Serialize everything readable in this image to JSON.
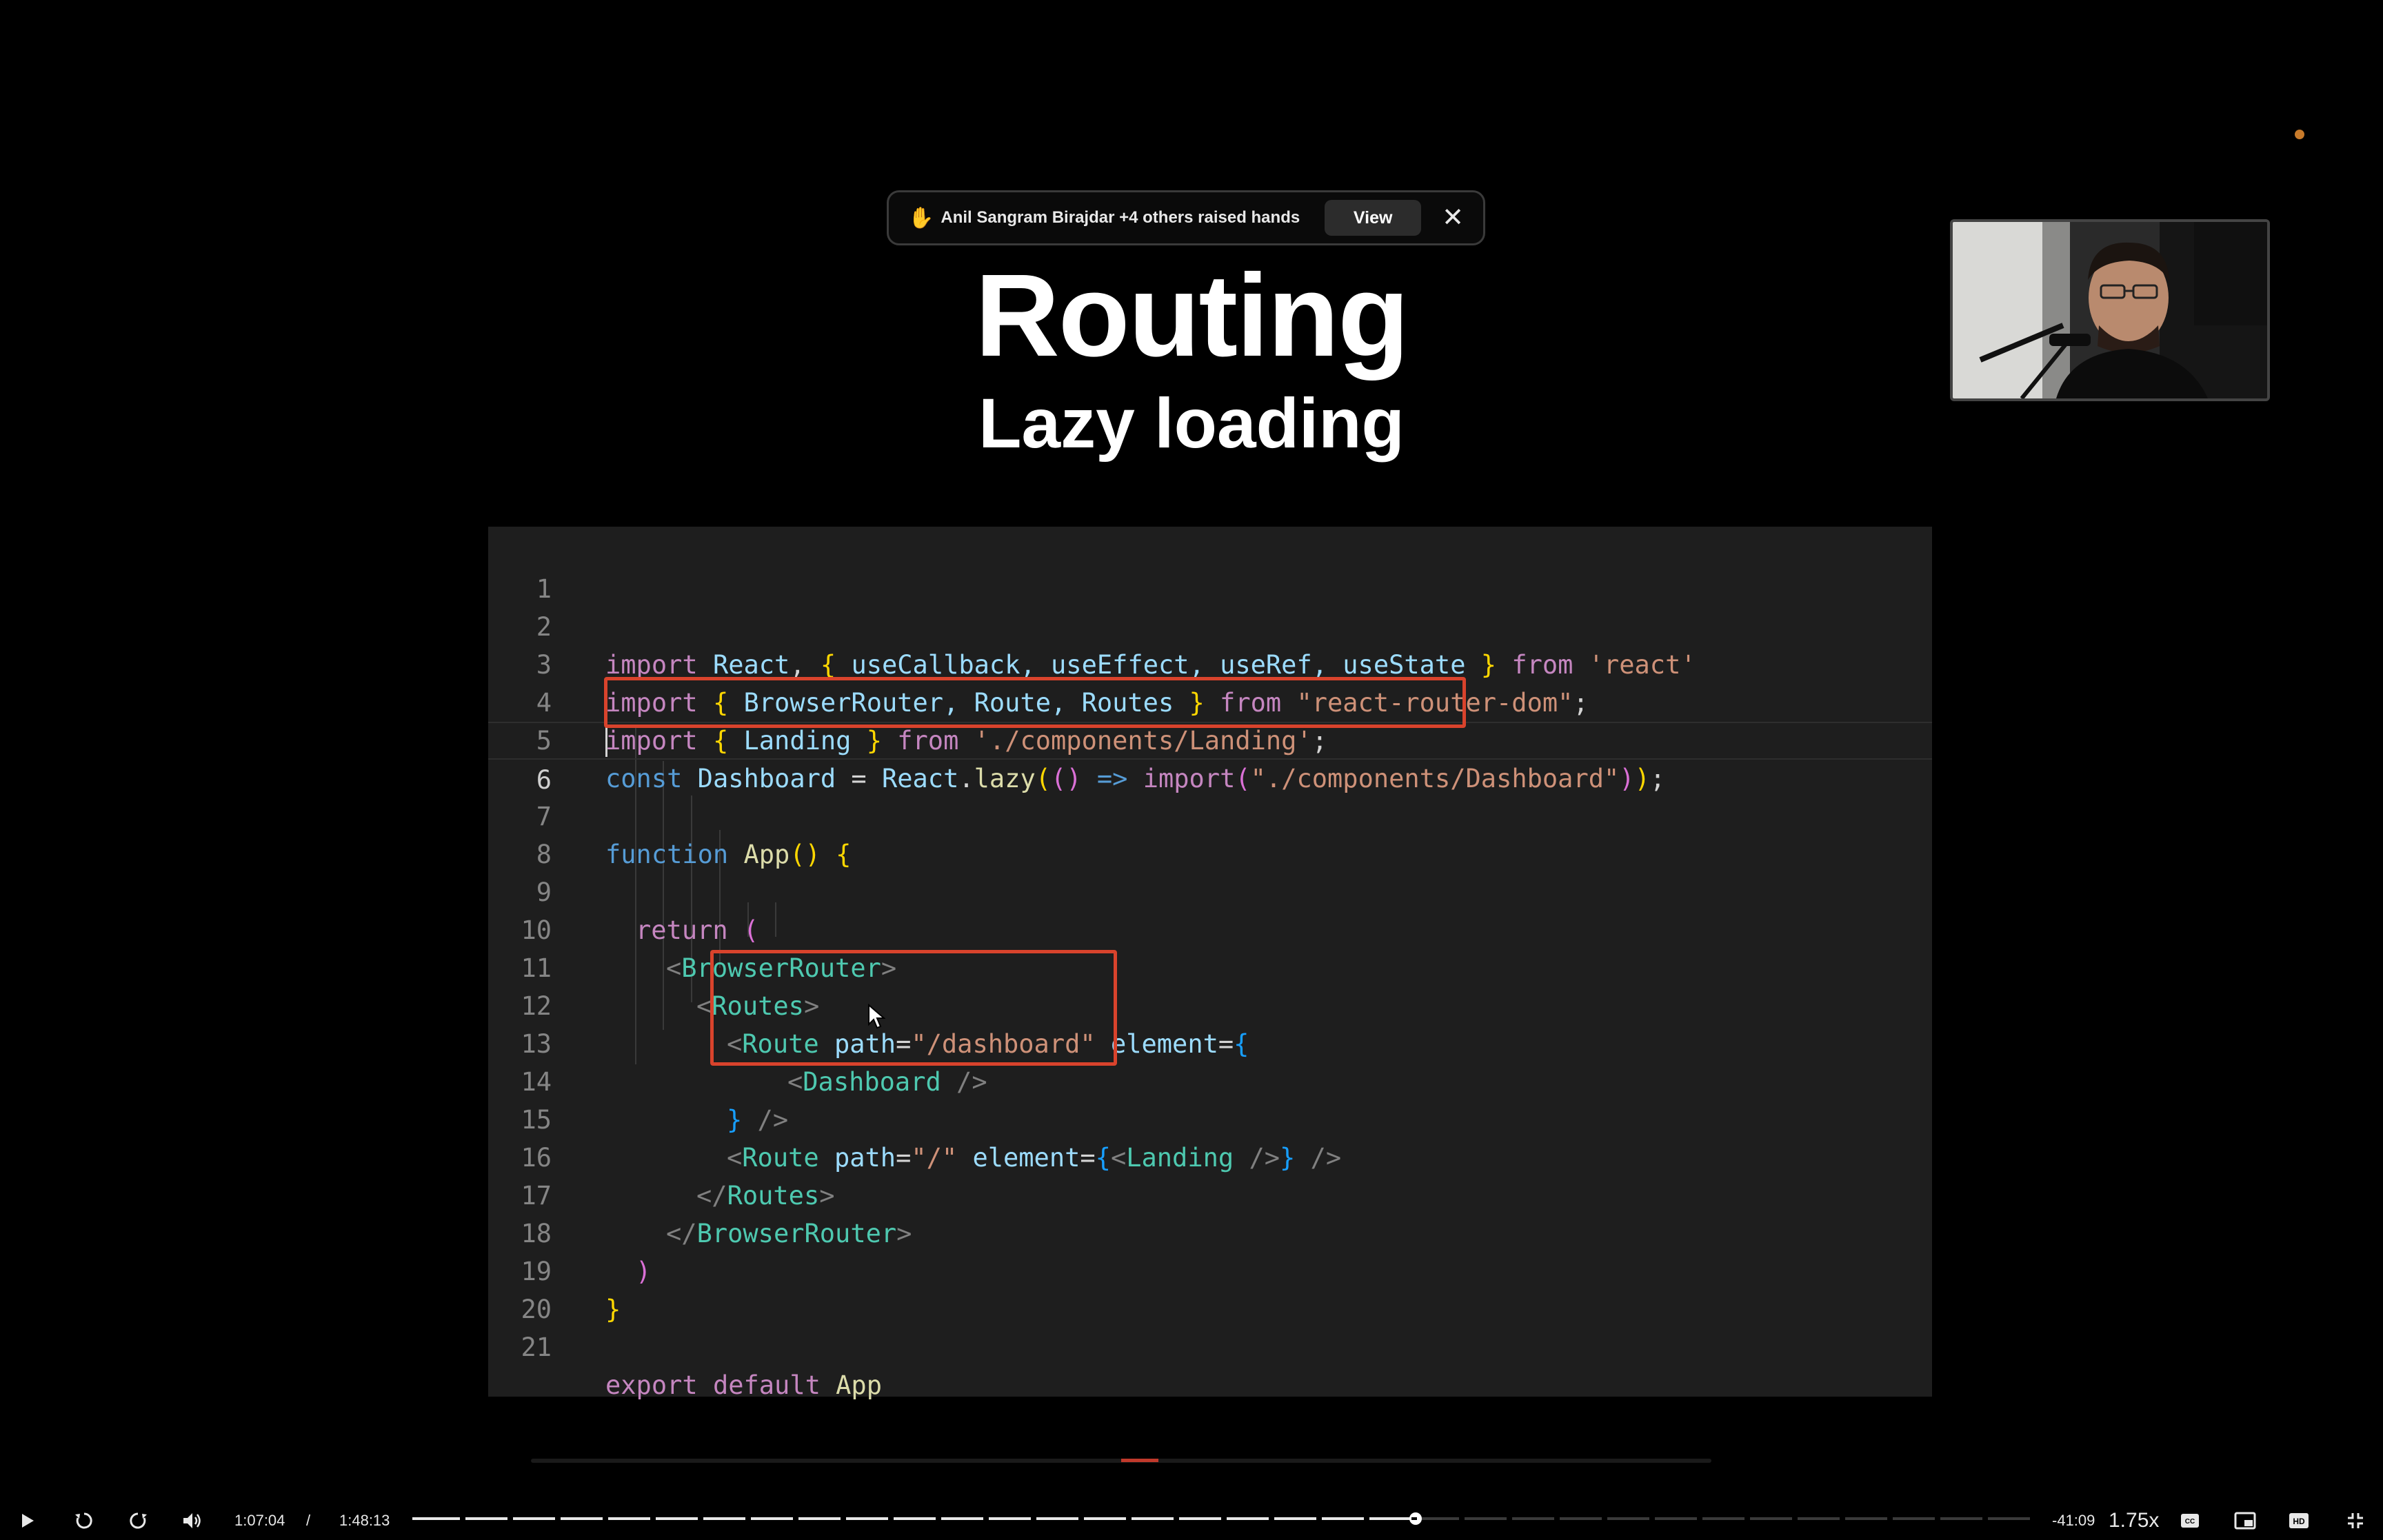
{
  "banner": {
    "message": "Anil Sangram Birajdar +4 others raised hands",
    "view_label": "View",
    "hand_icon": "raised-hand-icon",
    "close_icon": "close-icon"
  },
  "slide": {
    "title": "Routing",
    "subtitle": "Lazy loading"
  },
  "code": {
    "lines": [
      {
        "n": "1"
      },
      {
        "n": "2"
      },
      {
        "n": "3"
      },
      {
        "n": "4"
      },
      {
        "n": "5"
      },
      {
        "n": "6"
      },
      {
        "n": "7"
      },
      {
        "n": "8"
      },
      {
        "n": "9"
      },
      {
        "n": "10"
      },
      {
        "n": "11"
      },
      {
        "n": "12"
      },
      {
        "n": "13"
      },
      {
        "n": "14"
      },
      {
        "n": "15"
      },
      {
        "n": "16"
      },
      {
        "n": "17"
      },
      {
        "n": "18"
      },
      {
        "n": "19"
      },
      {
        "n": "20"
      },
      {
        "n": "21"
      }
    ],
    "tokens": {
      "l2": [
        "import",
        " ",
        "React",
        ", ",
        "{",
        " useCallback, useEffect, useRef, useState ",
        "}",
        " from ",
        "'react'"
      ],
      "l3": [
        "import",
        " ",
        "{",
        " BrowserRouter, Route, Routes ",
        "}",
        " from ",
        "\"react-router-dom\"",
        ";"
      ],
      "l4": [
        "import",
        " ",
        "{",
        " Landing ",
        "}",
        " from ",
        "'./components/Landing'",
        ";"
      ],
      "l5": [
        "const",
        " ",
        "Dashboard",
        " = ",
        "React",
        ".",
        "lazy",
        "(",
        "()",
        " => ",
        "import",
        "(",
        "\"./components/Dashboard\"",
        ")",
        ")",
        ";"
      ],
      "l7": [
        "function",
        " ",
        "App",
        "()",
        " ",
        "{"
      ],
      "l9": [
        "return",
        " ",
        "("
      ],
      "l10": [
        "<",
        "BrowserRouter",
        ">"
      ],
      "l11": [
        "<",
        "Routes",
        ">"
      ],
      "l12": [
        "<",
        "Route",
        " ",
        "path",
        "=",
        "\"/dashboard\"",
        " ",
        "element",
        "=",
        "{"
      ],
      "l13": [
        "<",
        "Dashboard",
        " />"
      ],
      "l14": [
        "}",
        " />"
      ],
      "l15": [
        "<",
        "Route",
        " ",
        "path",
        "=",
        "\"/\"",
        " ",
        "element",
        "=",
        "{",
        "<",
        "Landing",
        " />",
        "}",
        " />"
      ],
      "l16": [
        "</",
        "Routes",
        ">"
      ],
      "l17": [
        "</",
        "BrowserRouter",
        ">"
      ],
      "l18": [
        ")"
      ],
      "l19": [
        "}"
      ],
      "l21": [
        "export",
        " ",
        "default",
        " ",
        "App"
      ]
    }
  },
  "player": {
    "current_time": "1:07:04",
    "separator": "/",
    "duration": "1:48:13",
    "remaining": "-41:09",
    "speed": "1.75x",
    "progress_fraction": 0.62,
    "icons": {
      "play": "play-icon",
      "rewind": "rewind-icon",
      "forward": "forward-icon",
      "volume": "volume-icon",
      "captions": "captions-icon",
      "pip": "picture-in-picture-icon",
      "hd": "hd-icon",
      "exit_fullscreen": "exit-fullscreen-icon"
    }
  },
  "colors": {
    "highlight_box": "#d9432c",
    "code_bg": "#1e1e1e",
    "recording_dot": "#c87a2a"
  }
}
